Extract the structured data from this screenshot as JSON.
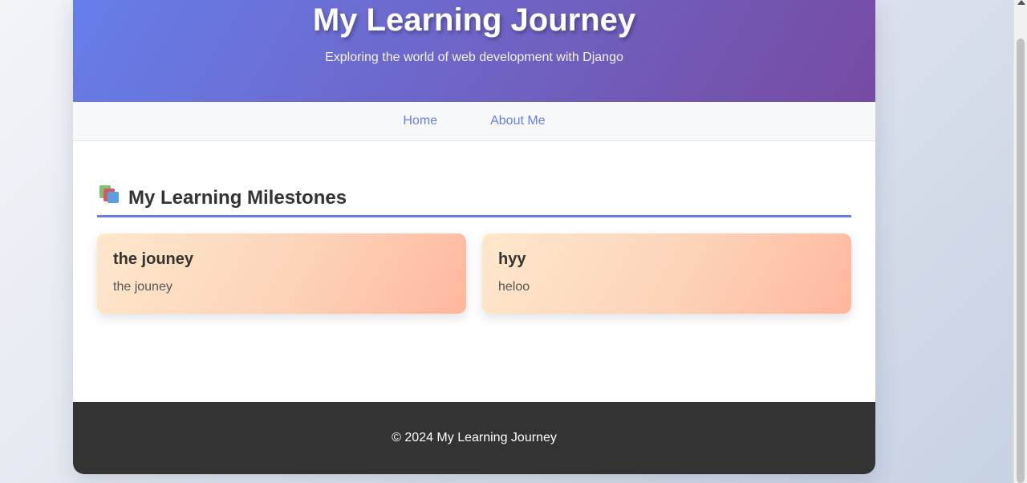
{
  "header": {
    "title": "My Learning Journey",
    "subtitle": "Exploring the world of web development with Django"
  },
  "nav": {
    "items": [
      {
        "label": "Home"
      },
      {
        "label": "About Me"
      }
    ]
  },
  "section": {
    "icon": "books-icon",
    "title": "My Learning Milestones"
  },
  "milestones": [
    {
      "title": "the jouney",
      "description": "the jouney"
    },
    {
      "title": "hyy",
      "description": "heloo"
    }
  ],
  "footer": {
    "text": "© 2024 My Learning Journey"
  },
  "colors": {
    "header_gradient_start": "#667eea",
    "header_gradient_end": "#764ba2",
    "accent": "#667eea",
    "card_gradient_start": "#ffe8cc",
    "card_gradient_end": "#ffb79d",
    "footer_bg": "#333333"
  }
}
